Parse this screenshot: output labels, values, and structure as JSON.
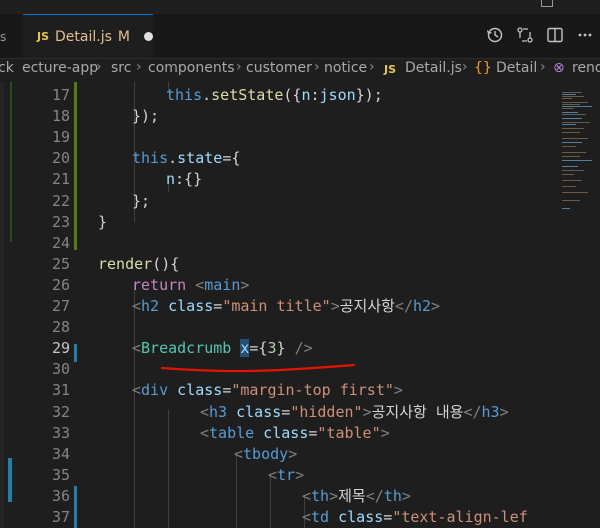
{
  "tab": {
    "lang_badge": "JS",
    "filename": "Detail.js",
    "modified_flag": "M"
  },
  "tab_actions": [
    "history-icon",
    "compare-icon",
    "split-editor-icon",
    "more-icon"
  ],
  "left_edge_text": "s",
  "breadcrumb": {
    "items": [
      "ck",
      "ecture-app",
      "src",
      "components",
      "customer",
      "notice"
    ],
    "file_badge": "JS",
    "file": "Detail.js",
    "symbol_icon": "{}",
    "symbol": "Detail",
    "tail_icon": "⊗",
    "tail": "rend"
  },
  "lines": [
    {
      "n": "17",
      "tokens": [
        [
          "kw",
          "this"
        ],
        [
          "txt",
          "."
        ],
        [
          "fn",
          "setState"
        ],
        [
          "txt",
          "({"
        ],
        [
          "prop",
          "n"
        ],
        [
          "txt",
          ":"
        ],
        [
          "prop",
          "json"
        ],
        [
          "txt",
          "});"
        ]
      ],
      "indent": 3
    },
    {
      "n": "18",
      "tokens": [
        [
          "txt",
          "});"
        ]
      ],
      "indent": 2
    },
    {
      "n": "19",
      "tokens": [],
      "indent": 0
    },
    {
      "n": "20",
      "tokens": [
        [
          "kw",
          "this"
        ],
        [
          "txt",
          "."
        ],
        [
          "prop",
          "state"
        ],
        [
          "txt",
          "={"
        ]
      ],
      "indent": 2
    },
    {
      "n": "21",
      "tokens": [
        [
          "prop",
          "n"
        ],
        [
          "txt",
          ":{}"
        ]
      ],
      "indent": 3
    },
    {
      "n": "22",
      "tokens": [
        [
          "txt",
          "};"
        ]
      ],
      "indent": 2
    },
    {
      "n": "23",
      "tokens": [
        [
          "txt",
          "}"
        ]
      ],
      "indent": 1
    },
    {
      "n": "24",
      "tokens": [],
      "indent": 0
    },
    {
      "n": "25",
      "tokens": [
        [
          "fn",
          "render"
        ],
        [
          "txt",
          "(){"
        ]
      ],
      "indent": 1
    },
    {
      "n": "26",
      "tokens": [
        [
          "kw2",
          "return"
        ],
        [
          "txt",
          " "
        ],
        [
          "punc",
          "<"
        ],
        [
          "tag",
          "main"
        ],
        [
          "punc",
          ">"
        ]
      ],
      "indent": 2
    },
    {
      "n": "27",
      "tokens": [
        [
          "punc",
          "<"
        ],
        [
          "tag",
          "h2"
        ],
        [
          "txt",
          " "
        ],
        [
          "attr",
          "class"
        ],
        [
          "txt",
          "="
        ],
        [
          "str",
          "\"main title\""
        ],
        [
          "punc",
          ">"
        ],
        [
          "txt",
          "공지사항"
        ],
        [
          "punc",
          "</"
        ],
        [
          "tag",
          "h2"
        ],
        [
          "punc",
          ">"
        ]
      ],
      "indent": 2
    },
    {
      "n": "28",
      "tokens": [],
      "indent": 0
    },
    {
      "n": "29",
      "tokens": [
        [
          "punc",
          "<"
        ],
        [
          "comp",
          "Breadcrumb"
        ],
        [
          "txt",
          " "
        ],
        [
          "attrsel",
          "x"
        ],
        [
          "txt",
          "={"
        ],
        [
          "num",
          "3"
        ],
        [
          "txt",
          "}"
        ],
        [
          "txt",
          " "
        ],
        [
          "punc",
          "/>"
        ]
      ],
      "indent": 2,
      "active": true
    },
    {
      "n": "30",
      "tokens": [],
      "indent": 0
    },
    {
      "n": "31",
      "tokens": [
        [
          "punc",
          "<"
        ],
        [
          "tag",
          "div"
        ],
        [
          "txt",
          " "
        ],
        [
          "attr",
          "class"
        ],
        [
          "txt",
          "="
        ],
        [
          "str",
          "\"margin-top first\""
        ],
        [
          "punc",
          ">"
        ]
      ],
      "indent": 2
    },
    {
      "n": "32",
      "tokens": [
        [
          "punc",
          "<"
        ],
        [
          "tag",
          "h3"
        ],
        [
          "txt",
          " "
        ],
        [
          "attr",
          "class"
        ],
        [
          "txt",
          "="
        ],
        [
          "str",
          "\"hidden\""
        ],
        [
          "punc",
          ">"
        ],
        [
          "txt",
          "공지사항 내용"
        ],
        [
          "punc",
          "</"
        ],
        [
          "tag",
          "h3"
        ],
        [
          "punc",
          ">"
        ]
      ],
      "indent": 4
    },
    {
      "n": "33",
      "tokens": [
        [
          "punc",
          "<"
        ],
        [
          "tag",
          "table"
        ],
        [
          "txt",
          " "
        ],
        [
          "attr",
          "class"
        ],
        [
          "txt",
          "="
        ],
        [
          "str",
          "\"table\""
        ],
        [
          "punc",
          ">"
        ]
      ],
      "indent": 4
    },
    {
      "n": "34",
      "tokens": [
        [
          "punc",
          "<"
        ],
        [
          "tag",
          "tbody"
        ],
        [
          "punc",
          ">"
        ]
      ],
      "indent": 5
    },
    {
      "n": "35",
      "tokens": [
        [
          "punc",
          "<"
        ],
        [
          "tag",
          "tr"
        ],
        [
          "punc",
          ">"
        ]
      ],
      "indent": 6
    },
    {
      "n": "36",
      "tokens": [
        [
          "punc",
          "<"
        ],
        [
          "tag",
          "th"
        ],
        [
          "punc",
          ">"
        ],
        [
          "txt",
          "제목"
        ],
        [
          "punc",
          "</"
        ],
        [
          "tag",
          "th"
        ],
        [
          "punc",
          ">"
        ]
      ],
      "indent": 7
    },
    {
      "n": "37",
      "tokens": [
        [
          "punc",
          "<"
        ],
        [
          "tag",
          "td"
        ],
        [
          "txt",
          " "
        ],
        [
          "attr",
          "class"
        ],
        [
          "txt",
          "="
        ],
        [
          "str",
          "\"text-align-lef"
        ]
      ],
      "indent": 7
    }
  ],
  "colors": {
    "editor_bg": "#1e1e1e",
    "tab_accent": "#0078d4",
    "modified_text": "#e2c08d",
    "annotation_red": "#e51400",
    "diff_added": "#587c0c",
    "diff_modified": "#1b81a8"
  }
}
